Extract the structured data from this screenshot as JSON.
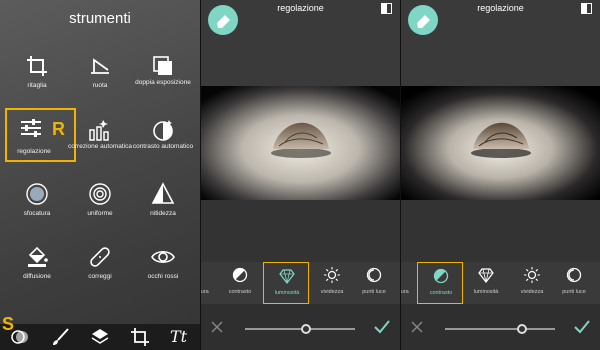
{
  "tools_panel": {
    "title": "strumenti",
    "tools": [
      {
        "label": "ritaglia",
        "icon": "crop-icon"
      },
      {
        "label": "ruota",
        "icon": "rotate-icon"
      },
      {
        "label": "doppia esposizione",
        "icon": "double-exposure-icon"
      },
      {
        "label": "regolazione",
        "icon": "adjust-sliders-icon",
        "selected": true
      },
      {
        "label": "correzione automatica",
        "icon": "auto-fix-icon"
      },
      {
        "label": "contrasto automatico",
        "icon": "auto-contrast-icon"
      },
      {
        "label": "sfocatura",
        "icon": "blur-icon"
      },
      {
        "label": "uniforme",
        "icon": "smooth-icon"
      },
      {
        "label": "nitidezza",
        "icon": "sharpen-icon"
      },
      {
        "label": "diffusione",
        "icon": "dispersion-icon"
      },
      {
        "label": "correggi",
        "icon": "heal-bandage-icon"
      },
      {
        "label": "occhi rossi",
        "icon": "red-eye-icon"
      }
    ],
    "badge_r": "R",
    "badge_s": "S",
    "bottom_bar": [
      "effects-icon",
      "brush-icon",
      "layers-icon",
      "crop-tool-icon",
      "text-icon"
    ],
    "text_tool_glyph": "Tt"
  },
  "edit_panels": [
    {
      "title": "regolazione",
      "options": [
        "tura",
        "contrasto",
        "luminosità",
        "vividezza",
        "punti luce"
      ],
      "selected": "luminosità",
      "slider": 0.55
    },
    {
      "title": "regolazione",
      "options": [
        "tura",
        "contrasto",
        "luminosità",
        "vividezza",
        "punti luce"
      ],
      "selected": "contrasto",
      "slider": 0.7
    }
  ],
  "colors": {
    "accent": "#7fd6c4",
    "highlight": "#f0b400",
    "background": "#333333"
  }
}
